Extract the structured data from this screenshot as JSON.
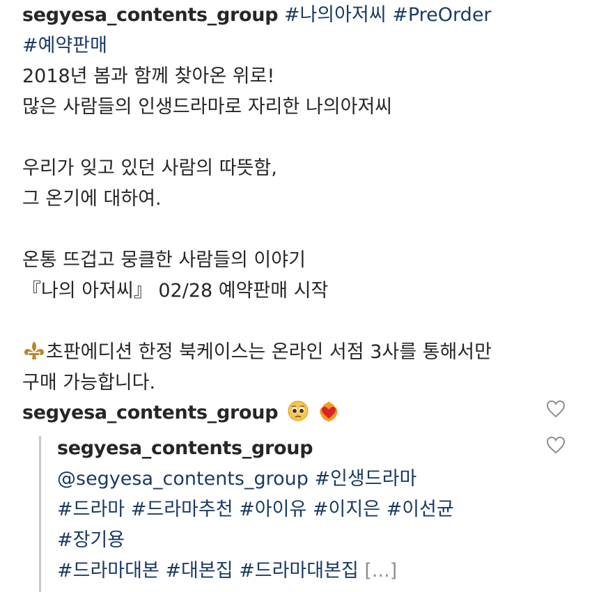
{
  "caption": {
    "username": "segyesa_contents_group",
    "hashtags_line1": "#나의아저씨 #PreOrder",
    "hashtags_line2": "#예약판매",
    "lines": [
      "2018년 봄과 함께 찾아온 위로!",
      "많은 사람들의 인생드라마로 자리한 나의아저씨",
      "",
      "우리가 잊고 있던 사람의 따뜻함,",
      "그 온기에 대하여.",
      "",
      "온통 뜨겁고 뭉클한 사람들의 이야기",
      "『나의 아저씨』 02/28 예약판매 시작",
      ""
    ],
    "bookcase_line1": "초판에디션 한정 북케이스는 온라인 서점 3사를 통해서만",
    "bookcase_line2": "구매 가능합니다."
  },
  "comment": {
    "username": "segyesa_contents_group",
    "emojis": [
      "pleading-face-emoji",
      "heart-on-fire-emoji"
    ]
  },
  "reply": {
    "username": "segyesa_contents_group",
    "line1": "@segyesa_contents_group #인생드라마",
    "line2": "#드라마 #드라마추천 #아이유 #이지은 #이선균",
    "line3": "#장기용",
    "line4": "#드라마대본 #대본집 #드라마대본집",
    "more": "[...]"
  },
  "colors": {
    "hashtag": "#1a3a63",
    "text": "#262626",
    "muted": "#8e8e8e"
  }
}
